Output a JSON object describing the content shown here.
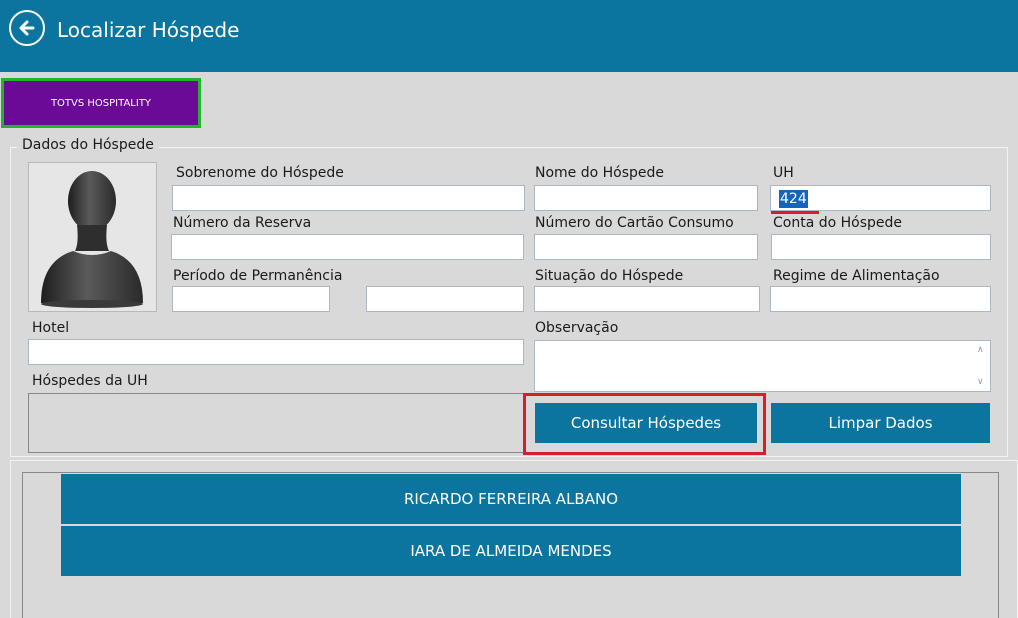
{
  "header": {
    "title": "Localizar Hóspede",
    "back_icon": "arrow-left-icon"
  },
  "brand": {
    "label": "TOTVS HOSPITALITY"
  },
  "guest_form": {
    "group_title": "Dados do Hóspede",
    "labels": {
      "surname": "Sobrenome do Hóspede",
      "name": "Nome do Hóspede",
      "uh": "UH",
      "reservation_number": "Número da Reserva",
      "consumption_card": "Número do Cartão Consumo",
      "guest_account": "Conta do Hóspede",
      "stay_period": "Período de Permanência",
      "guest_status": "Situação do Hóspede",
      "meal_plan": "Regime de Alimentação",
      "hotel": "Hotel",
      "notes": "Observação",
      "uh_guests": "Hóspedes da UH"
    },
    "values": {
      "uh": "424"
    }
  },
  "buttons": {
    "search": "Consultar Hóspedes",
    "clear": "Limpar Dados"
  },
  "results": [
    {
      "name": "RICARDO FERREIRA ALBANO"
    },
    {
      "name": "IARA DE ALMEIDA MENDES"
    }
  ],
  "colors": {
    "primary": "#0b75a0",
    "brand": "#6a0a96",
    "highlight_red": "#d51f2a",
    "highlight_green": "#22b52c"
  }
}
